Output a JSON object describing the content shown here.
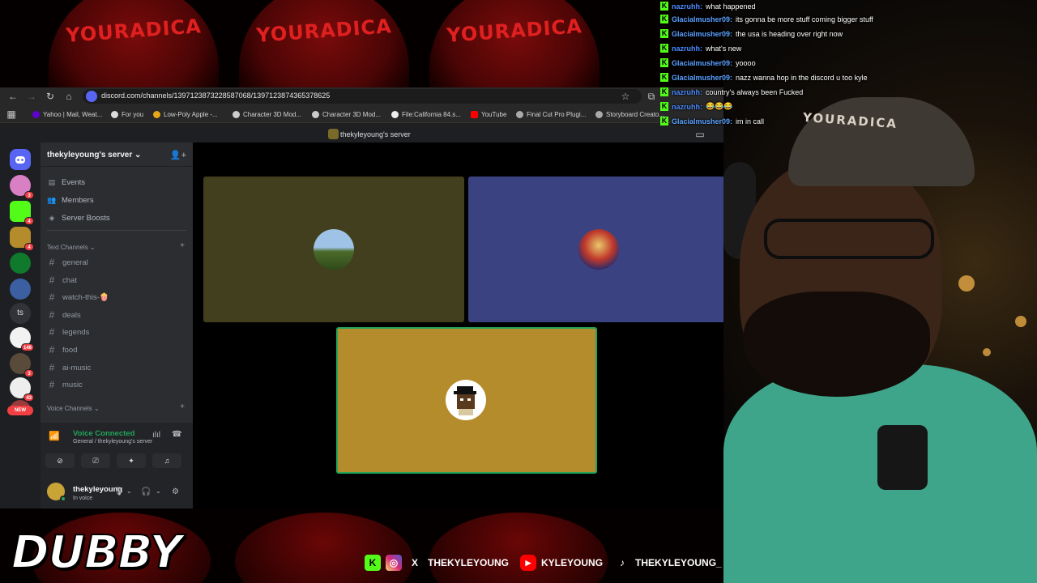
{
  "browser": {
    "url": "discord.com/channels/1397123873228587068/1397123874365378625",
    "bookmarks": [
      {
        "label": "Yahoo | Mail, Weat...",
        "color": "#6001d2"
      },
      {
        "label": "For you",
        "color": "#000000"
      },
      {
        "label": "Low-Poly Apple -...",
        "color": "#e6a817"
      },
      {
        "label": "Character 3D Mod...",
        "color": "#cccccc"
      },
      {
        "label": "Character 3D Mod...",
        "color": "#cccccc"
      },
      {
        "label": "File:California 84.s...",
        "color": "#eeeeee"
      },
      {
        "label": "YouTube",
        "color": "#ff0000"
      },
      {
        "label": "Final Cut Pro Plugi...",
        "color": "#aaaaaa"
      },
      {
        "label": "Storyboard Creato...",
        "color": "#aaaaaa"
      }
    ]
  },
  "discord": {
    "window_title": "thekyleyoung's server",
    "server_name": "thekyleyoung's server ⌄",
    "menu": [
      {
        "label": "Events",
        "icon": "calendar-icon"
      },
      {
        "label": "Members",
        "icon": "members-icon"
      },
      {
        "label": "Server Boosts",
        "icon": "boost-icon"
      }
    ],
    "text_category": "Text Channels ⌄",
    "channels": [
      "general",
      "chat",
      "watch-this-🍿",
      "deals",
      "legends",
      "food",
      "ai-music",
      "music"
    ],
    "voice_category": "Voice Channels ⌄",
    "guild_badges": [
      "3",
      "4",
      "4",
      "146",
      "3",
      "43"
    ],
    "new_label": "NEW",
    "guild_text_label": "ts",
    "voice": {
      "status": "Voice Connected",
      "location": "General / thekyleyoung's server"
    },
    "user": {
      "name": "thekyleyoung",
      "status": "In voice"
    },
    "tiles": [
      {
        "color": "#423f1f"
      },
      {
        "color": "#3b4282"
      },
      {
        "color": "#b58c2b",
        "speaking": true
      }
    ],
    "colors": {
      "accent": "#5865f2",
      "online": "#23a55a",
      "danger": "#f23f43"
    }
  },
  "chat": [
    {
      "user": "nazruhh:",
      "msg": "what happened",
      "color": "#4b8bff"
    },
    {
      "user": "Glacialmusher09:",
      "msg": "its gonna be more stuff coming bigger stuff",
      "color": "#5aa0ff"
    },
    {
      "user": "Glacialmusher09:",
      "msg": "the usa is heading over right now",
      "color": "#5aa0ff"
    },
    {
      "user": "nazruhh:",
      "msg": "what's new",
      "color": "#4b8bff"
    },
    {
      "user": "Glacialmusher09:",
      "msg": "yoooo",
      "color": "#5aa0ff"
    },
    {
      "user": "Glacialmusher09:",
      "msg": "nazz wanna hop in the discord u too kyle",
      "color": "#5aa0ff"
    },
    {
      "user": "nazruhh:",
      "msg": "country's always been Fucked",
      "color": "#4b8bff"
    },
    {
      "user": "nazruhh:",
      "msg": "😂😂😂",
      "color": "#4b8bff"
    },
    {
      "user": "Glacialmusher09:",
      "msg": "im in call",
      "color": "#5aa0ff"
    }
  ],
  "overlay": {
    "hat_text": "YOURADICA",
    "cam_cap_text": "YOURADICA",
    "logo": "DUBBY",
    "socials": [
      {
        "icon": "kick-icon",
        "color": "#53fc18",
        "glyph": "K",
        "label": ""
      },
      {
        "icon": "instagram-icon",
        "color": "#d62976",
        "glyph": "◎",
        "label": ""
      },
      {
        "icon": "x-icon",
        "color": "#000000",
        "glyph": "X",
        "label": "THEKYLEYOUNG"
      },
      {
        "icon": "youtube-icon",
        "color": "#ff0000",
        "glyph": "▶",
        "label": "KYLEYOUNG"
      },
      {
        "icon": "tiktok-icon",
        "color": "#000000",
        "glyph": "♪",
        "label": "THEKYLEYOUNG_"
      }
    ]
  }
}
